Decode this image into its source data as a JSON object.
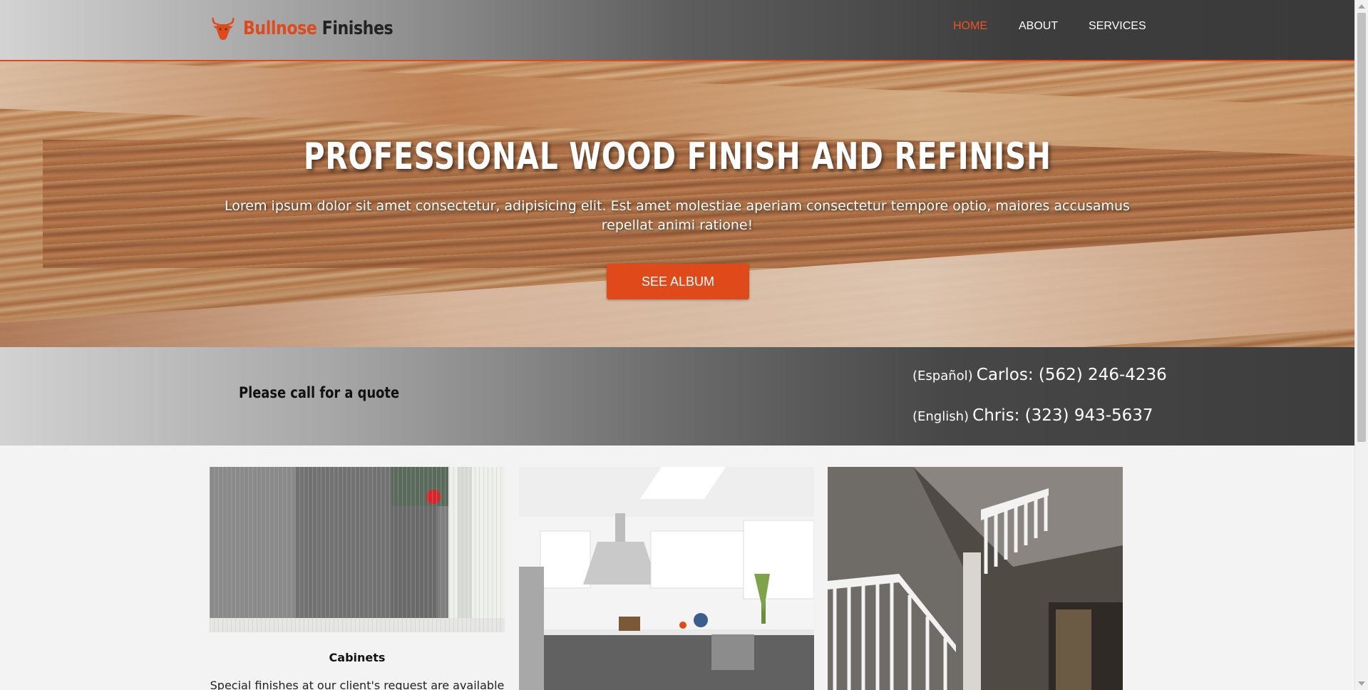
{
  "brand": {
    "part1": "Bullnose",
    "part2": "Finishes",
    "accent": "#e0491a",
    "icon": "bull-head-icon"
  },
  "nav": {
    "items": [
      {
        "label": "HOME",
        "active": true
      },
      {
        "label": "ABOUT",
        "active": false
      },
      {
        "label": "SERVICES",
        "active": false
      }
    ]
  },
  "hero": {
    "title": "PROFESSIONAL WOOD FINISH AND REFINISH",
    "text": "Lorem ipsum dolor sit amet consectetur, adipisicing elit. Est amet molestiae aperiam consectetur tempore optio, maiores accusamus repellat animi ratione!",
    "button": "SEE ALBUM"
  },
  "quote": {
    "text": "Please call for a quote",
    "phones": [
      {
        "lang": "(Español)",
        "name_number": "Carlos: (562) 246-4236"
      },
      {
        "lang": "(English)",
        "name_number": "Chris: (323) 943-5637"
      }
    ]
  },
  "cards": [
    {
      "title": "Cabinets",
      "desc": "Special finishes at our client's request are available"
    },
    {
      "title": "",
      "desc": ""
    },
    {
      "title": "",
      "desc": ""
    }
  ]
}
